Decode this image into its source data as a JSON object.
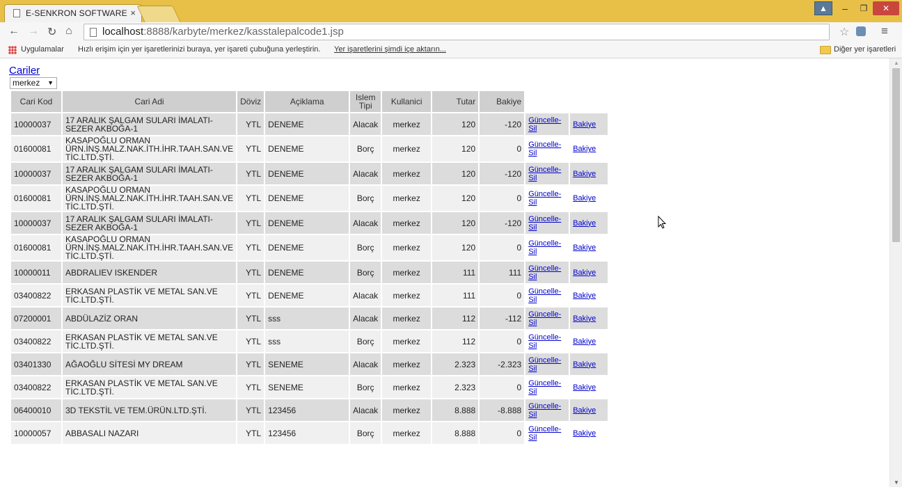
{
  "browser": {
    "tab_title": "E-SENKRON SOFTWARE",
    "tab_close": "×",
    "url_host": "localhost",
    "url_rest": ":8888/karbyte/merkez/kasstalepalcode1.jsp",
    "bookmarks": {
      "apps": "Uygulamalar",
      "hint": "Hızlı erişim için yer işaretlerinizi buraya, yer işareti çubuğuna yerleştirin.",
      "import_link": "Yer işaretlerini şimdi içe aktarın...",
      "other": "Diğer yer işaretleri"
    }
  },
  "page": {
    "cariler_link": "Cariler",
    "branch_select": "merkez",
    "headers": [
      "Cari Kod",
      "Cari Adi",
      "Döviz",
      "Açiklama",
      "Islem Tipi",
      "Kullanici",
      "Tutar",
      "Bakiye"
    ],
    "update_label": "Güncelle-Sil",
    "balance_label": "Bakiye",
    "rows": [
      {
        "kod": "10000037",
        "adi": "17 ARALIK ŞALGAM SULARI İMALATI-SEZER AKBOĞA-1",
        "doviz": "YTL",
        "aciklama": "DENEME",
        "islem": "Alacak",
        "kullanici": "merkez",
        "tutar": "120",
        "bakiye": "-120"
      },
      {
        "kod": "01600081",
        "adi": "KASAPOĞLU ORMAN ÜRN.İNŞ.MALZ.NAK.İTH.İHR.TAAH.SAN.VE TİC.LTD.ŞTİ.",
        "doviz": "YTL",
        "aciklama": "DENEME",
        "islem": "Borç",
        "kullanici": "merkez",
        "tutar": "120",
        "bakiye": "0"
      },
      {
        "kod": "10000037",
        "adi": "17 ARALIK ŞALGAM SULARI İMALATI-SEZER AKBOĞA-1",
        "doviz": "YTL",
        "aciklama": "DENEME",
        "islem": "Alacak",
        "kullanici": "merkez",
        "tutar": "120",
        "bakiye": "-120"
      },
      {
        "kod": "01600081",
        "adi": "KASAPOĞLU ORMAN ÜRN.İNŞ.MALZ.NAK.İTH.İHR.TAAH.SAN.VE TİC.LTD.ŞTİ.",
        "doviz": "YTL",
        "aciklama": "DENEME",
        "islem": "Borç",
        "kullanici": "merkez",
        "tutar": "120",
        "bakiye": "0"
      },
      {
        "kod": "10000037",
        "adi": "17 ARALIK ŞALGAM SULARI İMALATI-SEZER AKBOĞA-1",
        "doviz": "YTL",
        "aciklama": "DENEME",
        "islem": "Alacak",
        "kullanici": "merkez",
        "tutar": "120",
        "bakiye": "-120"
      },
      {
        "kod": "01600081",
        "adi": "KASAPOĞLU ORMAN ÜRN.İNŞ.MALZ.NAK.İTH.İHR.TAAH.SAN.VE TİC.LTD.ŞTİ.",
        "doviz": "YTL",
        "aciklama": "DENEME",
        "islem": "Borç",
        "kullanici": "merkez",
        "tutar": "120",
        "bakiye": "0"
      },
      {
        "kod": "10000011",
        "adi": "ABDRALIEV ISKENDER",
        "doviz": "YTL",
        "aciklama": "DENEME",
        "islem": "Borç",
        "kullanici": "merkez",
        "tutar": "111",
        "bakiye": "111"
      },
      {
        "kod": "03400822",
        "adi": "ERKASAN PLASTİK VE METAL SAN.VE TİC.LTD.ŞTİ.",
        "doviz": "YTL",
        "aciklama": "DENEME",
        "islem": "Alacak",
        "kullanici": "merkez",
        "tutar": "111",
        "bakiye": "0"
      },
      {
        "kod": "07200001",
        "adi": "ABDÜLAZİZ ORAN",
        "doviz": "YTL",
        "aciklama": "sss",
        "islem": "Alacak",
        "kullanici": "merkez",
        "tutar": "112",
        "bakiye": "-112"
      },
      {
        "kod": "03400822",
        "adi": "ERKASAN PLASTİK VE METAL SAN.VE TİC.LTD.ŞTİ.",
        "doviz": "YTL",
        "aciklama": "sss",
        "islem": "Borç",
        "kullanici": "merkez",
        "tutar": "112",
        "bakiye": "0"
      },
      {
        "kod": "03401330",
        "adi": "AĞAOĞLU SİTESİ MY DREAM",
        "doviz": "YTL",
        "aciklama": "SENEME",
        "islem": "Alacak",
        "kullanici": "merkez",
        "tutar": "2.323",
        "bakiye": "-2.323"
      },
      {
        "kod": "03400822",
        "adi": "ERKASAN PLASTİK VE METAL SAN.VE TİC.LTD.ŞTİ.",
        "doviz": "YTL",
        "aciklama": "SENEME",
        "islem": "Borç",
        "kullanici": "merkez",
        "tutar": "2.323",
        "bakiye": "0"
      },
      {
        "kod": "06400010",
        "adi": "3D TEKSTİL VE TEM.ÜRÜN.LTD.ŞTİ.",
        "doviz": "YTL",
        "aciklama": "123456",
        "islem": "Alacak",
        "kullanici": "merkez",
        "tutar": "8.888",
        "bakiye": "-8.888"
      },
      {
        "kod": "10000057",
        "adi": "ABBASALI NAZARI",
        "doviz": "YTL",
        "aciklama": "123456",
        "islem": "Borç",
        "kullanici": "merkez",
        "tutar": "8.888",
        "bakiye": "0"
      }
    ]
  }
}
